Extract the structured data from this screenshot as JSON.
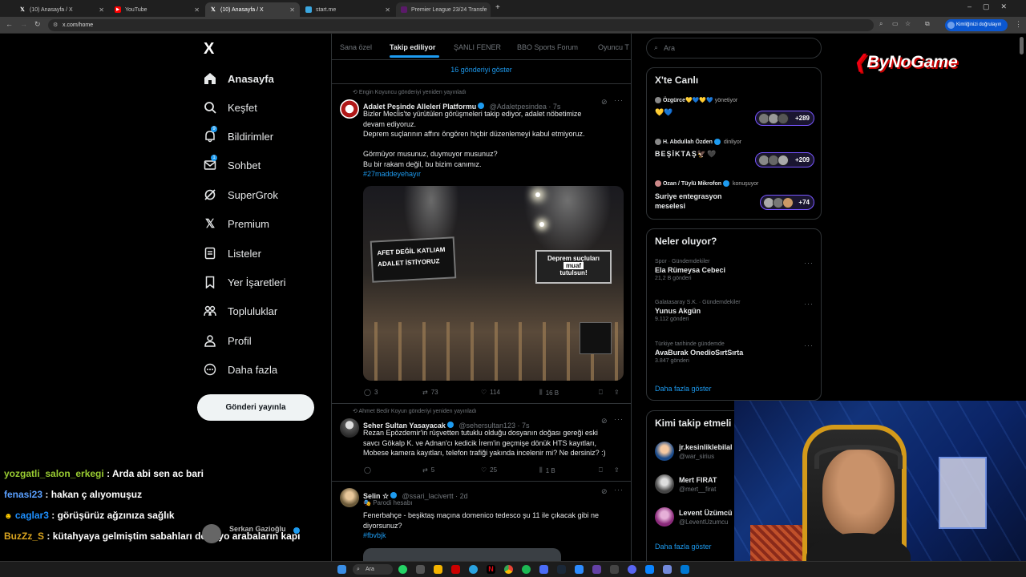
{
  "browser": {
    "tabs": [
      {
        "title": "(10) Anasayfa / X",
        "icon": "x-logo-icon",
        "active": false
      },
      {
        "title": "YouTube",
        "icon": "youtube-icon",
        "active": false
      },
      {
        "title": "(10) Anasayfa / X",
        "icon": "x-logo-icon",
        "active": true
      },
      {
        "title": "start.me",
        "icon": "startme-icon",
        "active": false
      },
      {
        "title": "Premier League 23/24 Transfe",
        "icon": "premier-league-icon",
        "active": false
      }
    ],
    "url": "x.com/home",
    "profile_label": "Kimliğinizi doğrulayın"
  },
  "sidebar": {
    "logo": "X",
    "items": [
      {
        "label": "Anasayfa",
        "icon": "home-icon"
      },
      {
        "label": "Keşfet",
        "icon": "search-icon"
      },
      {
        "label": "Bildirimler",
        "icon": "bell-icon",
        "badge": "9"
      },
      {
        "label": "Sohbet",
        "icon": "mail-icon",
        "badge": "1"
      },
      {
        "label": "SuperGrok",
        "icon": "grok-icon"
      },
      {
        "label": "Premium",
        "icon": "x-logo-icon"
      },
      {
        "label": "Listeler",
        "icon": "list-icon"
      },
      {
        "label": "Yer İşaretleri",
        "icon": "bookmark-icon"
      },
      {
        "label": "Topluluklar",
        "icon": "communities-icon"
      },
      {
        "label": "Profil",
        "icon": "person-icon"
      },
      {
        "label": "Daha fazla",
        "icon": "more-circle-icon"
      }
    ],
    "post_button": "Gönderi yayınla",
    "account_name": "Serkan Gazioğlu"
  },
  "feed": {
    "tabs": [
      "Sana özel",
      "Takip ediliyor",
      "ŞANLI FENER",
      "BBO Sports Forum",
      "Oyuncu T"
    ],
    "active_tab": 1,
    "show_new": "16 gönderiyi göster",
    "tweets": [
      {
        "retweeted_by": "Engin Koyuncu gönderiyi yeniden yayınladı",
        "name": "Adalet Peşinde Allelerí Platformu",
        "handle": "@Adaletpesindea · 7s",
        "lines": [
          "Bizler Meclis'te yürütülen görüşmeleri takip ediyor, adalet nöbetimize",
          "devam ediyoruz.",
          "Deprem suçlarının affını öngören hiçbir düzenlemeyi kabul etmiyoruz.",
          "",
          "Görmüyor musunuz, duymuyor musunuz?",
          "Bu bir rakam değil, bu bizim canımız."
        ],
        "hashtag": "#27maddeyehayır",
        "image_signs": [
          "AFET DEĞİL KATLIAM",
          "ADALET İSTİYORUZ",
          "Deprem suçluları",
          "muaf",
          "tutulsun!"
        ],
        "replies": "3",
        "retweets": "73",
        "likes": "114",
        "views": "16 B"
      },
      {
        "retweeted_by": "Ahmet Bedir Koyun gönderiyi yeniden yayınladı",
        "name": "Seher Sultan Yasayacak",
        "handle": "@sehersultan123 · 7s",
        "lines": [
          "Rezan Epözdemir'in rüşvetten tutuklu olduğu dosyanın doğası gereği eski",
          "savcı Gökalp K. ve Adnan'cı kedicik İrem'in geçmişe dönük HTS kayıtları,",
          "Mobese kamera kayıtları, telefon trafiği yakında incelenir mi? Ne dersiniz? :)"
        ],
        "replies": "",
        "retweets": "5",
        "likes": "25",
        "views": "1 B"
      },
      {
        "name": "Selin ☆",
        "handle": "@ssari_lacivertt · 2d",
        "parody": "Parodi hesabı",
        "lines": [
          "Fenerbahçe - beşiktaş maçına domenico tedesco şu 11 ile çıkacak gibi ne",
          "diyorsunuz?"
        ],
        "hashtag": "#fbvbjk"
      }
    ]
  },
  "right": {
    "search_placeholder": "Ara",
    "live": {
      "title": "X'te Canlı",
      "items": [
        {
          "host": "Özgürce💛💙💛💙",
          "role": "yönetiyor",
          "topic": "💛💙",
          "count": "+289"
        },
        {
          "host": "H. Abdullah Özden",
          "role": "dinliyor",
          "topic": "BEŞİKTAŞ🦅🖤",
          "count": "+209"
        },
        {
          "host": "Ozan / Tüylü Mikrofon",
          "role": "konuşuyor",
          "topic": "Suriye entegrasyon meselesi",
          "count": "+74"
        }
      ]
    },
    "trends": {
      "title": "Neler oluyor?",
      "items": [
        {
          "meta": "Spor · Gündemdekiler",
          "name": "Ela Rümeysa Cebeci",
          "count": "21,2 B gönderi"
        },
        {
          "meta": "Galatasaray S.K. · Gündemdekiler",
          "name": "Yunus Akgün",
          "count": "9.112 gönderi"
        },
        {
          "meta": "Türkiye tarihinde gündemde",
          "name": "AvaBurak OnedioSırtSırta",
          "count": "3.847 gönderi"
        }
      ],
      "more": "Daha fazla göster"
    },
    "follow": {
      "title": "Kimi takip etmeli",
      "items": [
        {
          "name": "jr.kesinliklebilal",
          "handle": "@war_sirius"
        },
        {
          "name": "Mert FIRAT",
          "handle": "@mert__firat"
        },
        {
          "name": "Levent Üzümcü",
          "handle": "@LeventUzumcu"
        }
      ],
      "more": "Daha fazla göster"
    }
  },
  "overlay": {
    "brand": "ByNoGame",
    "chat": [
      {
        "user": "yozgatli_salon_erkegi",
        "message": ": Arda abi sen ac bari",
        "color": "#9acd32"
      },
      {
        "user": "fenasi23",
        "message": ": hakan ç alıyomuşuz",
        "color": "#5aa0ff"
      },
      {
        "user": "caglar3",
        "message": ": görüşürüz ağzınıza sağlık",
        "color": "#1e90ff"
      },
      {
        "user": "BuzZz_S",
        "message": ": kütahyaya gelmiştim sabahları donuyo arabaların kapı",
        "color": "#daa520"
      }
    ]
  },
  "taskbar": {
    "search": "Ara"
  }
}
